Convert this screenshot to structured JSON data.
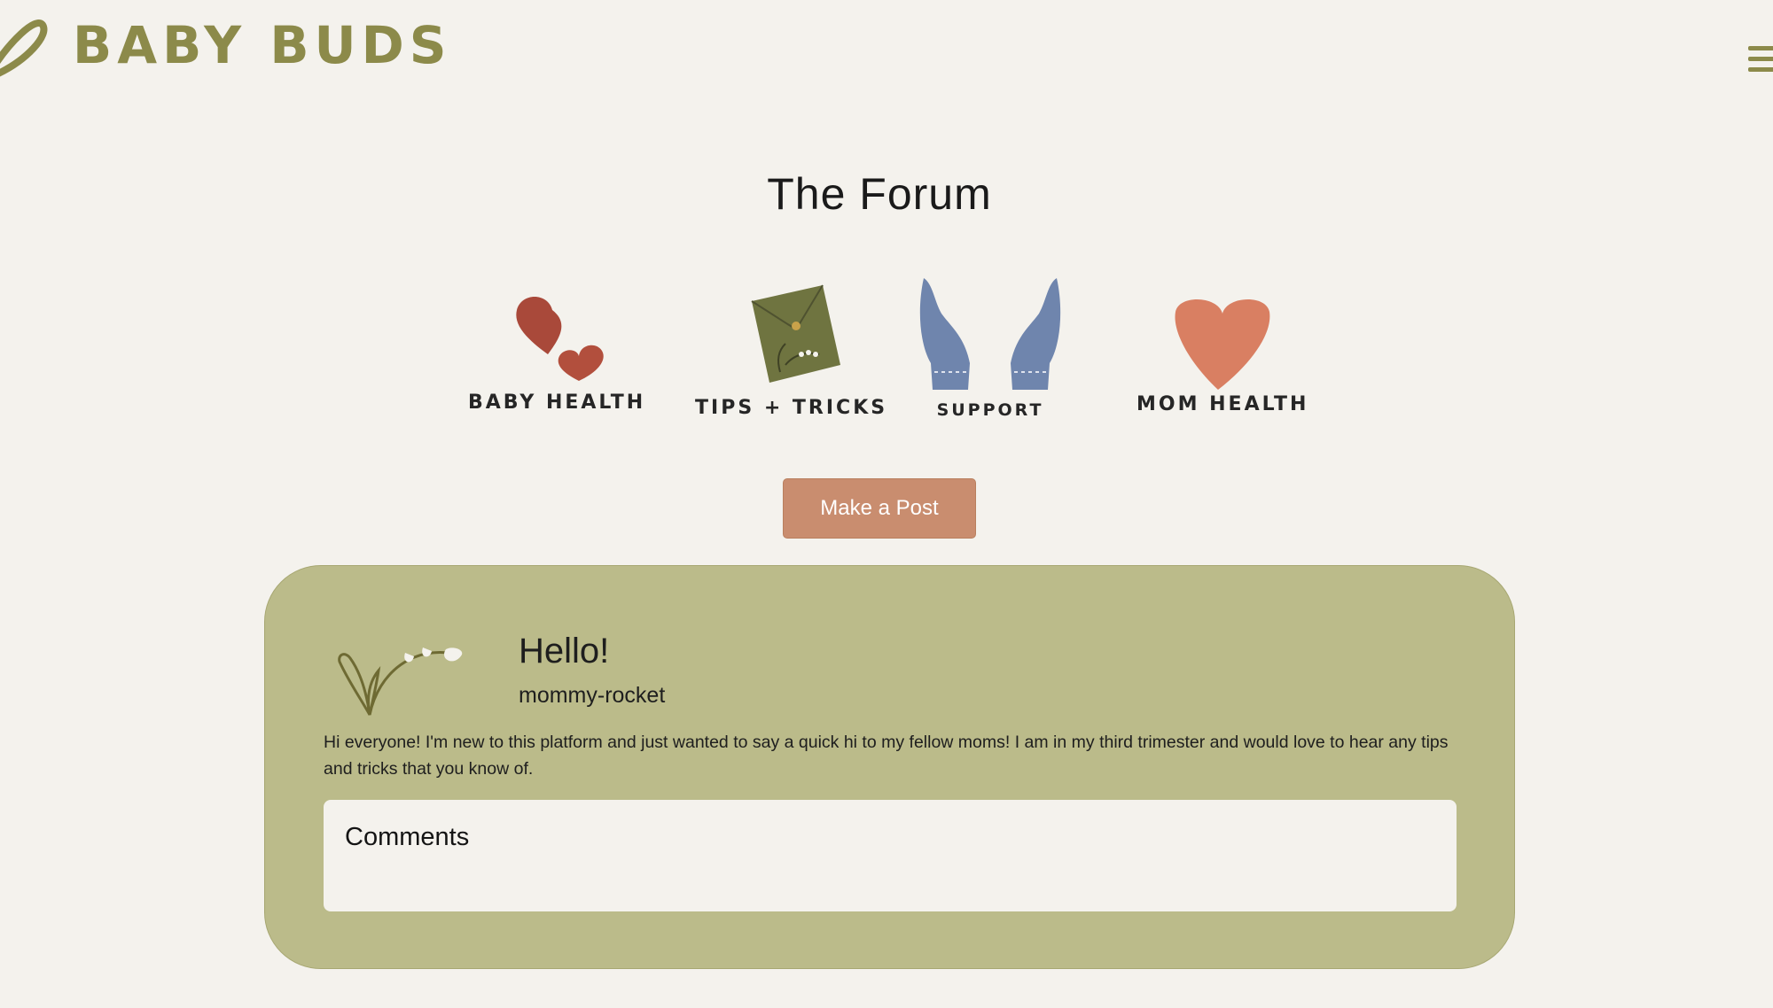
{
  "brand": {
    "name": "BABY BUDS",
    "accent_color": "#8c8a4a"
  },
  "header": {
    "menu_icon": "hamburger-menu-icon"
  },
  "page": {
    "title": "The Forum"
  },
  "categories": [
    {
      "label": "BABY HEALTH",
      "icon": "two-hearts-icon"
    },
    {
      "label": "TIPS + TRICKS",
      "icon": "envelope-flower-icon"
    },
    {
      "label": "SUPPORT",
      "icon": "reaching-hands-icon"
    },
    {
      "label": "MOM HEALTH",
      "icon": "heart-icon"
    }
  ],
  "actions": {
    "make_post_label": "Make a Post",
    "button_color": "#c98d6f"
  },
  "posts": [
    {
      "title": "Hello!",
      "author": "mommy-rocket",
      "avatar_icon": "lily-of-the-valley-icon",
      "body": "Hi everyone! I'm new to this platform and just wanted to say a quick hi to my fellow moms! I am in my third trimester and would love to hear any tips and tricks that you know of.",
      "comments_label": "Comments",
      "card_color": "#bbbb8a"
    }
  ]
}
